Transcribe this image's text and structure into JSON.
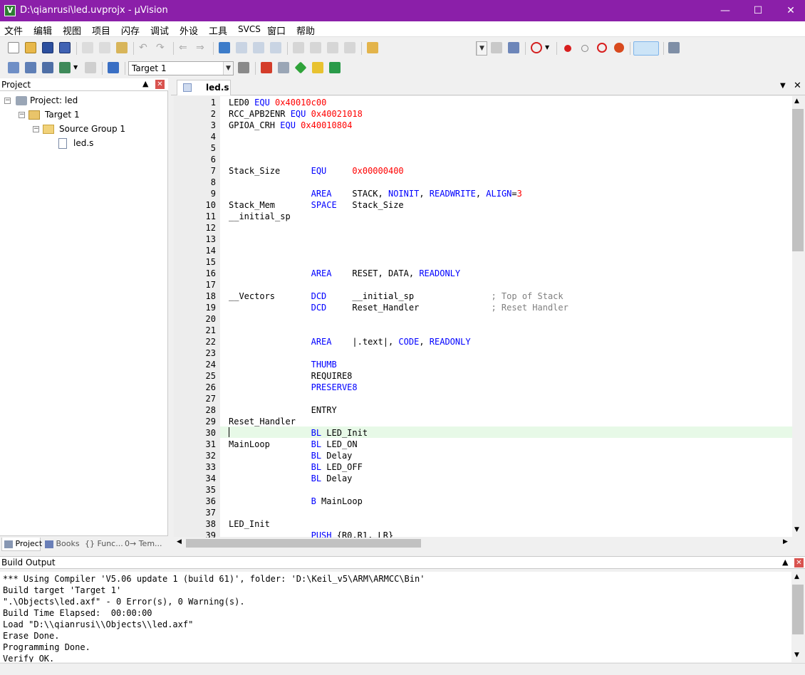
{
  "window": {
    "title": "D:\\qianrusi\\led.uvprojx - µVision"
  },
  "menu": [
    "文件",
    "编辑",
    "视图",
    "项目",
    "闪存",
    "调试",
    "外设",
    "工具",
    "SVCS",
    "窗口",
    "帮助"
  ],
  "toolbar2": {
    "target": "Target 1"
  },
  "project_panel": {
    "title": "Project",
    "tree": {
      "project": "Project: led",
      "target": "Target 1",
      "group": "Source Group 1",
      "file": "led.s"
    },
    "tabs": [
      "Project",
      "Books",
      "{} Func...",
      "0→ Tem..."
    ]
  },
  "editor": {
    "tab": "led.s",
    "lines": [
      {
        "n": "1",
        "t": [
          [
            "LED0 ",
            ""
          ],
          [
            "EQU",
            "kw"
          ],
          [
            " ",
            ""
          ],
          [
            "0x40010c00",
            "num"
          ]
        ]
      },
      {
        "n": "2",
        "t": [
          [
            "RCC_APB2ENR ",
            ""
          ],
          [
            "EQU",
            "kw"
          ],
          [
            " ",
            ""
          ],
          [
            "0x40021018",
            "num"
          ]
        ]
      },
      {
        "n": "3",
        "t": [
          [
            "GPIOA_CRH ",
            ""
          ],
          [
            "EQU",
            "kw"
          ],
          [
            " ",
            ""
          ],
          [
            "0x40010804",
            "num"
          ]
        ]
      },
      {
        "n": "4",
        "t": []
      },
      {
        "n": "5",
        "t": []
      },
      {
        "n": "6",
        "t": []
      },
      {
        "n": "7",
        "t": [
          [
            "Stack_Size      ",
            ""
          ],
          [
            "EQU",
            "kw"
          ],
          [
            "     ",
            ""
          ],
          [
            "0x00000400",
            "num"
          ]
        ]
      },
      {
        "n": "8",
        "t": []
      },
      {
        "n": "9",
        "t": [
          [
            "                ",
            ""
          ],
          [
            "AREA",
            "kw"
          ],
          [
            "    STACK, ",
            ""
          ],
          [
            "NOINIT",
            "kw"
          ],
          [
            ", ",
            ""
          ],
          [
            "READWRITE",
            "kw"
          ],
          [
            ", ",
            ""
          ],
          [
            "ALIGN",
            "kw"
          ],
          [
            "=",
            ""
          ],
          [
            "3",
            "num"
          ]
        ]
      },
      {
        "n": "10",
        "t": [
          [
            "Stack_Mem       ",
            ""
          ],
          [
            "SPACE",
            "kw"
          ],
          [
            "   Stack_Size",
            ""
          ]
        ]
      },
      {
        "n": "11",
        "t": [
          [
            "__initial_sp",
            ""
          ]
        ]
      },
      {
        "n": "12",
        "t": []
      },
      {
        "n": "13",
        "t": []
      },
      {
        "n": "14",
        "t": []
      },
      {
        "n": "15",
        "t": []
      },
      {
        "n": "16",
        "t": [
          [
            "                ",
            ""
          ],
          [
            "AREA",
            "kw"
          ],
          [
            "    RESET, DATA, ",
            ""
          ],
          [
            "READONLY",
            "kw"
          ]
        ]
      },
      {
        "n": "17",
        "t": []
      },
      {
        "n": "18",
        "t": [
          [
            "__Vectors       ",
            ""
          ],
          [
            "DCD",
            "kw"
          ],
          [
            "     __initial_sp               ",
            ""
          ],
          [
            "; Top of Stack",
            "cm"
          ]
        ]
      },
      {
        "n": "19",
        "t": [
          [
            "                ",
            ""
          ],
          [
            "DCD",
            "kw"
          ],
          [
            "     Reset_Handler              ",
            ""
          ],
          [
            "; Reset Handler",
            "cm"
          ]
        ]
      },
      {
        "n": "20",
        "t": []
      },
      {
        "n": "21",
        "t": []
      },
      {
        "n": "22",
        "t": [
          [
            "                ",
            ""
          ],
          [
            "AREA",
            "kw"
          ],
          [
            "    |.text|, ",
            ""
          ],
          [
            "CODE",
            "kw"
          ],
          [
            ", ",
            ""
          ],
          [
            "READONLY",
            "kw"
          ]
        ]
      },
      {
        "n": "23",
        "t": []
      },
      {
        "n": "24",
        "t": [
          [
            "                ",
            ""
          ],
          [
            "THUMB",
            "kw"
          ]
        ]
      },
      {
        "n": "25",
        "t": [
          [
            "                REQUIRE8",
            ""
          ]
        ]
      },
      {
        "n": "26",
        "t": [
          [
            "                ",
            ""
          ],
          [
            "PRESERVE8",
            "kw"
          ]
        ]
      },
      {
        "n": "27",
        "t": []
      },
      {
        "n": "28",
        "t": [
          [
            "                ENTRY",
            ""
          ]
        ]
      },
      {
        "n": "29",
        "t": [
          [
            "Reset_Handler",
            ""
          ]
        ]
      },
      {
        "n": "30",
        "t": [
          [
            "                ",
            ""
          ],
          [
            "BL",
            "kw"
          ],
          [
            " LED_Init",
            ""
          ]
        ],
        "hl": true
      },
      {
        "n": "31",
        "t": [
          [
            "MainLoop        ",
            ""
          ],
          [
            "BL",
            "kw"
          ],
          [
            " LED_ON",
            ""
          ]
        ]
      },
      {
        "n": "32",
        "t": [
          [
            "                ",
            ""
          ],
          [
            "BL",
            "kw"
          ],
          [
            " Delay",
            ""
          ]
        ]
      },
      {
        "n": "33",
        "t": [
          [
            "                ",
            ""
          ],
          [
            "BL",
            "kw"
          ],
          [
            " LED_OFF",
            ""
          ]
        ]
      },
      {
        "n": "34",
        "t": [
          [
            "                ",
            ""
          ],
          [
            "BL",
            "kw"
          ],
          [
            " Delay",
            ""
          ]
        ]
      },
      {
        "n": "35",
        "t": []
      },
      {
        "n": "36",
        "t": [
          [
            "                ",
            ""
          ],
          [
            "B",
            "kw"
          ],
          [
            " MainLoop",
            ""
          ]
        ]
      },
      {
        "n": "37",
        "t": []
      },
      {
        "n": "38",
        "t": [
          [
            "LED_Init",
            ""
          ]
        ]
      },
      {
        "n": "39",
        "t": [
          [
            "                ",
            ""
          ],
          [
            "PUSH",
            "kw"
          ],
          [
            " {R0,R1, LR}",
            ""
          ]
        ]
      }
    ]
  },
  "build_output": {
    "title": "Build Output",
    "lines": [
      "*** Using Compiler 'V5.06 update 1 (build 61)', folder: 'D:\\Keil_v5\\ARM\\ARMCC\\Bin'",
      "Build target 'Target 1'",
      "\".\\Objects\\led.axf\" - 0 Error(s), 0 Warning(s).",
      "Build Time Elapsed:  00:00:00",
      "Load \"D:\\\\qianrusi\\\\Objects\\\\led.axf\"",
      "Erase Done.",
      "Programming Done.",
      "Verify OK."
    ]
  },
  "colors": {
    "titlebar": "#8b1fa9",
    "keyword": "#0000ff",
    "number": "#ff0000",
    "comment": "#808080",
    "current_line": "#e7f9e7"
  }
}
